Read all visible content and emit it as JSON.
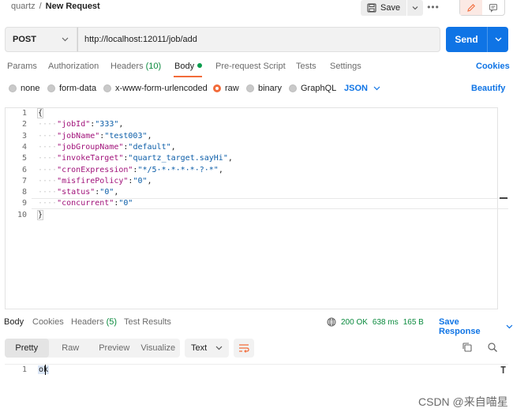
{
  "breadcrumb": {
    "collection": "quartz",
    "separator": "/",
    "request": "New Request"
  },
  "toolbar": {
    "save_label": "Save",
    "more_label": "•••"
  },
  "request": {
    "method": "POST",
    "url": "http://localhost:12011/job/add",
    "send_label": "Send"
  },
  "request_tabs": {
    "params": "Params",
    "authorization": "Authorization",
    "headers": "Headers",
    "headers_count": "(10)",
    "body": "Body",
    "pre_request": "Pre-request Script",
    "tests": "Tests",
    "settings": "Settings",
    "cookies": "Cookies"
  },
  "body_types": {
    "none": "none",
    "form_data": "form-data",
    "urlencoded": "x-www-form-urlencoded",
    "raw": "raw",
    "binary": "binary",
    "graphql": "GraphQL",
    "language": "JSON",
    "beautify": "Beautify",
    "selected": "raw"
  },
  "editor": {
    "lines": [
      {
        "no": "1",
        "indent": "",
        "key": "",
        "value": "",
        "text": "{"
      },
      {
        "no": "2",
        "indent": "····",
        "key": "\"jobId\"",
        "value": "\"333\"",
        "text": ","
      },
      {
        "no": "3",
        "indent": "····",
        "key": "\"jobName\"",
        "value": "\"test003\"",
        "text": ","
      },
      {
        "no": "4",
        "indent": "····",
        "key": "\"jobGroupName\"",
        "value": "\"default\"",
        "text": ","
      },
      {
        "no": "5",
        "indent": "····",
        "key": "\"invokeTarget\"",
        "value": "\"quartz_target.sayHi\"",
        "text": ","
      },
      {
        "no": "6",
        "indent": "····",
        "key": "\"cronExpression\"",
        "value": "\"*/5·*·*·*·*·?·*\"",
        "text": ","
      },
      {
        "no": "7",
        "indent": "····",
        "key": "\"misfirePolicy\"",
        "value": "\"0\"",
        "text": ","
      },
      {
        "no": "8",
        "indent": "····",
        "key": "\"status\"",
        "value": "\"0\"",
        "text": ","
      },
      {
        "no": "9",
        "indent": "····",
        "key": "\"concurrent\"",
        "value": "\"0\"",
        "text": ""
      },
      {
        "no": "10",
        "indent": "",
        "key": "",
        "value": "",
        "text": "}"
      }
    ]
  },
  "response_tabs": {
    "body": "Body",
    "cookies": "Cookies",
    "headers": "Headers",
    "headers_count": "(5)",
    "test_results": "Test Results"
  },
  "response_status": {
    "status": "200 OK",
    "time": "638 ms",
    "size": "165 B",
    "save_response": "Save Response"
  },
  "response_view": {
    "pretty": "Pretty",
    "raw": "Raw",
    "preview": "Preview",
    "visualize": "Visualize",
    "format": "Text",
    "selected": "Pretty"
  },
  "response_body": {
    "line_no": "1",
    "text": "ok"
  },
  "watermark": "CSDN @来自喵星",
  "colors": {
    "accent": "#f26b3a",
    "primary": "#0f74e5",
    "success": "#0b8a3e"
  }
}
